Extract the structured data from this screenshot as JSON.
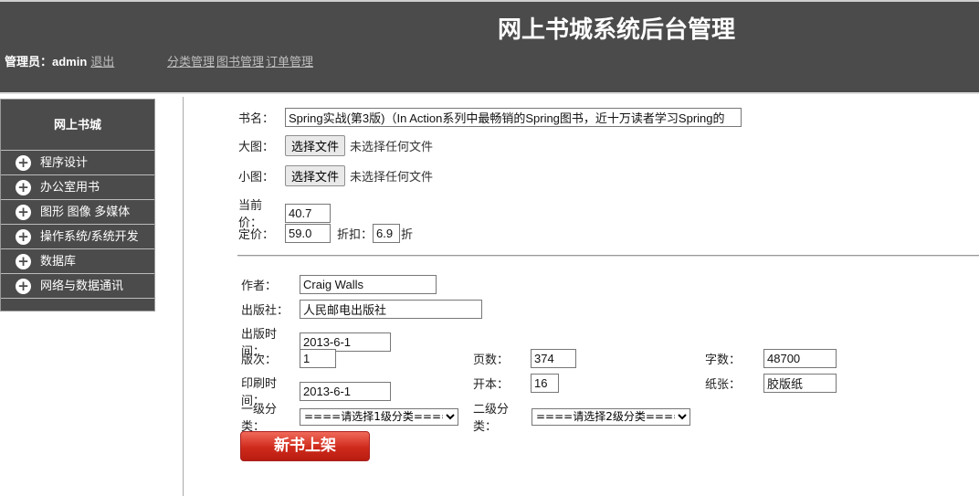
{
  "header": {
    "title": "网上书城系统后台管理",
    "admin_label": "管理员：admin",
    "logout": "退出",
    "nav": [
      "分类管理",
      "图书管理",
      "订单管理"
    ]
  },
  "sidebar": {
    "title": "网上书城",
    "items": [
      "程序设计",
      "办公室用书",
      "图形 图像 多媒体",
      "操作系统/系统开发",
      "数据库",
      "网络与数据通讯"
    ]
  },
  "form": {
    "name_label": "书名：",
    "name_value": "Spring实战(第3版)（In Action系列中最畅销的Spring图书，近十万读者学习Spring的",
    "big_image_label": "大图：",
    "small_image_label": "小图：",
    "choose_file": "选择文件",
    "no_file": "未选择任何文件",
    "current_price_label": "当前价：",
    "current_price": "40.7",
    "price_label": "定价：",
    "price": "59.0",
    "discount_label": "折扣：",
    "discount": "6.9",
    "discount_unit": "折",
    "author_label": "作者：",
    "author": "Craig Walls",
    "press_label": "出版社：",
    "press": "人民邮电出版社",
    "publish_time_label": "出版时间：",
    "publish_time": "2013-6-1",
    "edition_label": "版次：",
    "edition": "1",
    "pages_label": "页数：",
    "pages": "374",
    "words_label": "字数：",
    "words": "48700",
    "print_time_label": "印刷时间：",
    "print_time": "2013-6-1",
    "format_label": "开本：",
    "format": "16",
    "paper_label": "纸张：",
    "paper": "胶版纸",
    "cat1_label": "一级分类：",
    "cat1_option": "====请选择1级分类====",
    "cat2_label": "二级分类：",
    "cat2_option": "====请选择2级分类====",
    "submit": "新书上架"
  }
}
